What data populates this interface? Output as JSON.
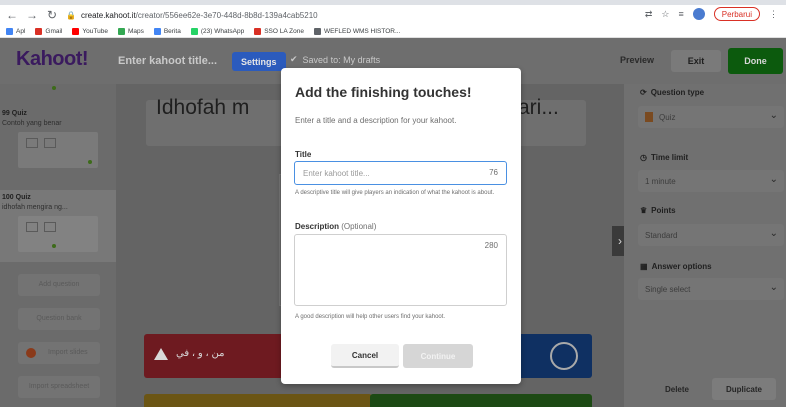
{
  "browser": {
    "url_host": "create.kahoot.it",
    "url_path": "/creator/556ee62e-3e70-448d-8b8d-139a4cab5210",
    "update_label": "Perbarui",
    "bookmarks": [
      {
        "label": "Apl",
        "color": "#4285f4"
      },
      {
        "label": "Gmail",
        "color": "#d93025"
      },
      {
        "label": "YouTube",
        "color": "#ff0000"
      },
      {
        "label": "Maps",
        "color": "#34a853"
      },
      {
        "label": "Berita",
        "color": "#4285f4"
      },
      {
        "label": "(23) WhatsApp",
        "color": "#25d366"
      },
      {
        "label": "SSO LA Zone",
        "color": "#d93025"
      },
      {
        "label": "WEFLED WMS HISTOR...",
        "color": "#5f6368"
      }
    ]
  },
  "header": {
    "logo": "Kahoot!",
    "title_placeholder": "Enter kahoot title...",
    "settings_label": "Settings",
    "saved_text": "Saved to: My drafts",
    "preview_label": "Preview",
    "exit_label": "Exit",
    "done_label": "Done"
  },
  "sidebar": {
    "slides": [
      {
        "num": "99",
        "type": "Quiz",
        "title": "Contoh yang benar"
      },
      {
        "num": "100",
        "type": "Quiz",
        "title": "idhofah mengira ng..."
      }
    ],
    "add_question": "Add question",
    "question_bank": "Question bank",
    "import_slides": "Import slides",
    "import_spreadsheet": "Import spreadsheet"
  },
  "canvas": {
    "question_text": "Idhofah m",
    "question_tail": "ari...",
    "answer_red": "من ، و ، في"
  },
  "right_panel": {
    "question_type_label": "Question type",
    "question_type_value": "Quiz",
    "time_limit_label": "Time limit",
    "time_limit_value": "1 minute",
    "points_label": "Points",
    "points_value": "Standard",
    "answer_options_label": "Answer options",
    "answer_options_value": "Single select",
    "delete_label": "Delete",
    "duplicate_label": "Duplicate"
  },
  "modal": {
    "title": "Add the finishing touches!",
    "subtitle": "Enter a title and a description for your kahoot.",
    "title_label": "Title",
    "title_placeholder": "Enter kahoot title...",
    "title_count": "76",
    "title_hint": "A descriptive title will give players an indication of what the kahoot is about.",
    "description_label": "Description",
    "description_optional": "(Optional)",
    "description_count": "280",
    "description_hint": "A good description will help other users find your kahoot.",
    "cancel_label": "Cancel",
    "continue_label": "Continue"
  }
}
